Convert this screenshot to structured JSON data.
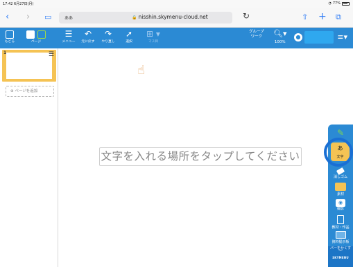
{
  "status_bar": {
    "time": "17:42  6月27日(月)",
    "battery": "77%"
  },
  "browser": {
    "aa_label": "ああ",
    "url": "nisshin.skymenu-cloud.net",
    "icons": [
      "back-icon",
      "forward-icon",
      "book-icon",
      "reload-icon",
      "share-icon",
      "plus-icon",
      "tabs-icon"
    ]
  },
  "toolbar": {
    "back_label": "もどる",
    "page_label": "ページ",
    "menu_label": "メニュー",
    "undo_label": "元に戻す",
    "redo_label": "やり直し",
    "select_label": "選択",
    "grid_label": "マス目",
    "group_label": "グループ\nワーク",
    "zoom": "100%"
  },
  "sidebar": {
    "page_number": "1",
    "add_page": "ページを追加"
  },
  "canvas": {
    "prompt": "文字を入れる場所をタップしてください"
  },
  "tools": {
    "text_glyph": "あ",
    "text_label": "文字",
    "eraser_label": "消しゴム",
    "material_label": "素材",
    "photo_label": "撮影",
    "work_label": "教材・作品",
    "frame_label": "資料提示板",
    "bar_label": "バーをかくす",
    "brand": "SKYMENU"
  }
}
